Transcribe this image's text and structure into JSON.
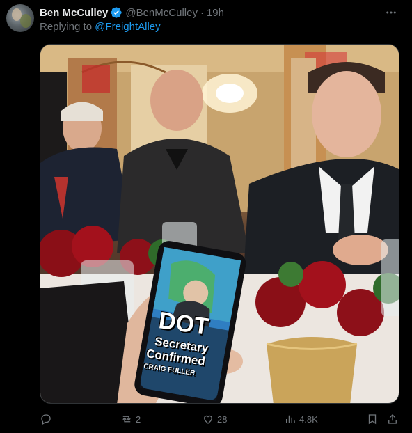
{
  "author": {
    "name": "Ben McCulley",
    "handle": "@BenMcCulley",
    "separator": "·",
    "time": "19h",
    "verified": true
  },
  "reply": {
    "prefix": "Replying to",
    "to": "@FreightAlley"
  },
  "phone_screen": {
    "headline": "DOT",
    "line1": "Secretary",
    "line2": "Confirmed",
    "byline": "CRAIG FULLER"
  },
  "actions": {
    "replies": "",
    "retweets": "2",
    "likes": "28",
    "views": "4.8K"
  },
  "colors": {
    "link": "#1d9bf0",
    "muted": "#71767b",
    "text": "#e7e9ea",
    "background": "#000000"
  },
  "icons": [
    "more-icon",
    "verified-icon",
    "reply-icon",
    "retweet-icon",
    "like-icon",
    "views-icon",
    "bookmark-icon",
    "share-icon"
  ]
}
